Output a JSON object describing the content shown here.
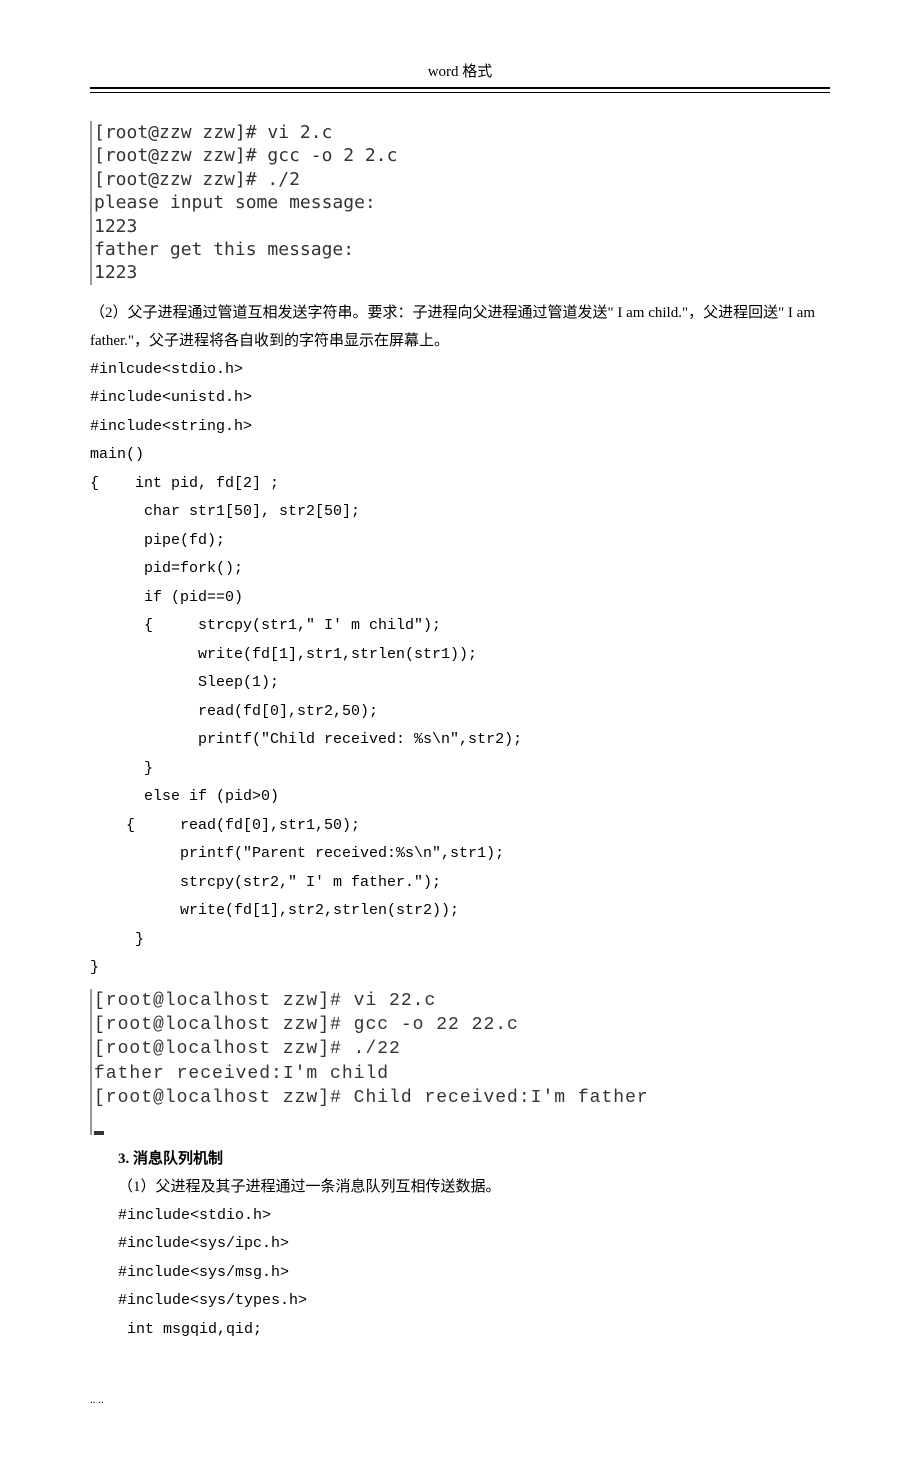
{
  "header": {
    "title": "word 格式"
  },
  "terminal1": {
    "lines": [
      "[root@zzw zzw]# vi 2.c",
      "[root@zzw zzw]# gcc -o 2 2.c",
      "[root@zzw zzw]# ./2",
      "please input some message:",
      "1223",
      "father get this message:",
      "1223"
    ]
  },
  "para2": {
    "prefix": "（2）父子进程通过管道互相发送字符串。要求：子进程向父进程通过管道发送\" I am child.\"，父进程回送\" I am father.\"，父子进程将各自收到的字符串显示在屏幕上。"
  },
  "code1": {
    "lines": [
      "#inlcude<stdio.h>",
      "#include<unistd.h>",
      "#include<string.h>",
      "main()",
      "{    int pid, fd[2] ;",
      "      char str1[50], str2[50];",
      "      pipe(fd);",
      "      pid=fork();",
      "      if (pid==0)",
      "      {     strcpy(str1,\" I' m child\");",
      "            write(fd[1],str1,strlen(str1));",
      "            Sleep(1);",
      "            read(fd[0],str2,50);",
      "            printf(\"Child received: %s\\n\",str2);",
      "      }",
      "      else if (pid>0)",
      "    {     read(fd[0],str1,50);",
      "          printf(\"Parent received:%s\\n\",str1);",
      "          strcpy(str2,\" I' m father.\");",
      "          write(fd[1],str2,strlen(str2));",
      "     }",
      "}"
    ]
  },
  "terminal2": {
    "lines": [
      "[root@localhost zzw]# vi 22.c",
      "[root@localhost zzw]# gcc -o 22 22.c",
      "[root@localhost zzw]# ./22",
      "father received:I'm child",
      "[root@localhost zzw]# Child received:I'm father"
    ]
  },
  "section3": {
    "num": "3.",
    "label": " 消息队列机制",
    "item1": "（1）父进程及其子进程通过一条消息队列互相传送数据。"
  },
  "code2": {
    "lines": [
      "#include<stdio.h>",
      "#include<sys/ipc.h>",
      "#include<sys/msg.h>",
      "#include<sys/types.h>",
      " int msgqid,qid;"
    ]
  },
  "footer": {
    "dots": "..   .."
  }
}
